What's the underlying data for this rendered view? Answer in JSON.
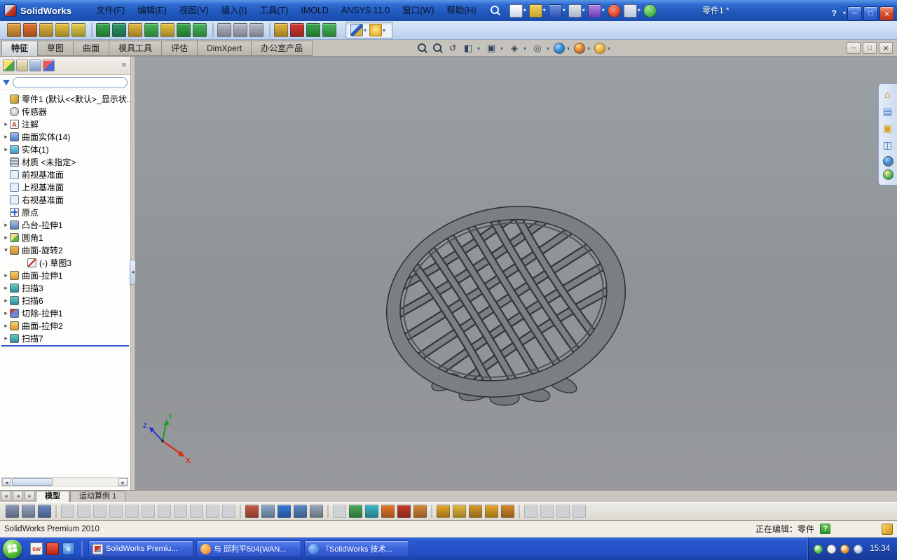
{
  "titlebar": {
    "app_name": "SolidWorks",
    "menus": [
      "文件(F)",
      "编辑(E)",
      "视图(V)",
      "插入(I)",
      "工具(T)",
      "IMOLD",
      "ANSYS 11.0",
      "窗口(W)",
      "帮助(H)"
    ],
    "doc_title": "零件1 *",
    "help_label": "?"
  },
  "command_tabs": {
    "items": [
      "特征",
      "草图",
      "曲面",
      "模具工具",
      "评估",
      "DimXpert",
      "办公室产品"
    ],
    "active": "特征"
  },
  "feature_tree": {
    "root_label": "零件1 (默认<<默认>_显示状...",
    "items": [
      "传感器",
      "注解",
      "曲面实体(14)",
      "实体(1)",
      "材质 <未指定>",
      "前视基准面",
      "上视基准面",
      "右视基准面",
      "原点",
      "凸台-拉伸1",
      "圆角1",
      "曲面-旋转2",
      "(-) 草图3",
      "曲面-拉伸1",
      "扫描3",
      "扫描6",
      "切除-拉伸1",
      "曲面-拉伸2",
      "扫描7"
    ]
  },
  "viewport": {
    "triad": {
      "x": "X",
      "y": "Y",
      "z": "Z"
    }
  },
  "doc_tabs": {
    "items": [
      "模型",
      "运动算例 1"
    ],
    "active": "模型"
  },
  "statusbar": {
    "left": "SolidWorks Premium 2010",
    "editing_label": "正在编辑：零件",
    "help_label": "?"
  },
  "taskbar": {
    "tasks": [
      "SolidWorks Premiu...",
      "与 邱利平504(WAN...",
      "『SolidWorks 技术..."
    ],
    "clock": "15:34"
  },
  "colors": {
    "titlebar_blue": "#2a62c8",
    "viewport_gray": "#919598",
    "model_gray": "#7b7f83",
    "model_edge": "#33373a",
    "taskbar_blue": "#2250c4",
    "selection_blue": "#2858c8"
  },
  "icon_strips": {
    "standard": [
      "#e8a23c",
      "#e8732f",
      "#e8b83c",
      "#e8c23c",
      "#e8d048",
      "|",
      "#38a848",
      "#2f9868",
      "#e8b83c",
      "#48b858",
      "#e8c23c",
      "#38a848",
      "#48b858",
      "|",
      "#b8bcc8",
      "#b8bcc8",
      "#b8bcc8",
      "|",
      "#e8b83c",
      "#d83830",
      "#38a848",
      "#48b858"
    ],
    "bottom": [
      "#8898b8",
      "#98a8c0",
      "#6888c0",
      "|",
      "_",
      "_",
      "_",
      "_",
      "_",
      "_",
      "_",
      "_",
      "_",
      "_",
      "_",
      "|",
      "#c85848",
      "#88a8c8",
      "#3878d8",
      "#5888c8",
      "#98a8b8",
      "|",
      "_",
      "#48a858",
      "#38b8c8",
      "#e87828",
      "#c83828",
      "#d88838",
      "|",
      "#e8a828",
      "#e8b838",
      "#d89828",
      "#e8a828",
      "#d88828",
      "|",
      "_",
      "_",
      "_",
      "_"
    ],
    "tray": [
      "#58c048",
      "#e8e8e8",
      "#e89828",
      "#b8c8e8"
    ]
  }
}
